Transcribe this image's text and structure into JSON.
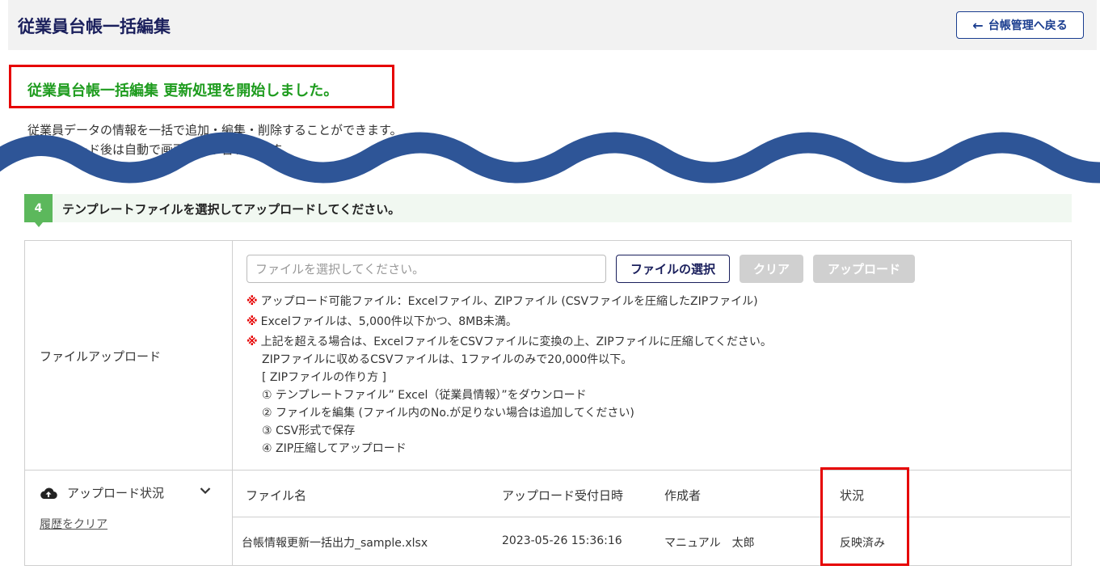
{
  "header": {
    "title": "従業員台帳一括編集",
    "back_button": "台帳管理へ戻る",
    "back_icon": "arrow-left-icon"
  },
  "alert": {
    "message": "従業員台帳一括編集 更新処理を開始しました。"
  },
  "description": {
    "line1": "従業員データの情報を一括で追加・編集・削除することができます。",
    "line2": "アップロード後は自動で画面が切り替わります。"
  },
  "step": {
    "number": "4",
    "text": "テンプレートファイルを選択してアップロードしてください。"
  },
  "upload": {
    "label": "ファイルアップロード",
    "placeholder": "ファイルを選択してください。",
    "select_button": "ファイルの選択",
    "clear_button": "クリア",
    "upload_button": "アップロード",
    "notes": [
      "アップロード可能ファイル：Excelファイル、ZIPファイル (CSVファイルを圧縮したZIPファイル)",
      "Excelファイルは、5,000件以下かつ、8MB未満。",
      "上記を超える場合は、ExcelファイルをCSVファイルに変換の上、ZIPファイルに圧縮してください。"
    ],
    "note_mark": "※",
    "sub_notes": [
      "ZIPファイルに収めるCSVファイルは、1ファイルのみで20,000件以下。",
      "[ ZIPファイルの作り方 ]",
      "① テンプレートファイル” Excel（従業員情報）”をダウンロード",
      "② ファイルを編集 (ファイル内のNo.が足りない場合は追加してください)",
      "③ CSV形式で保存",
      "④ ZIP圧縮してアップロード"
    ]
  },
  "status": {
    "title": "アップロード状況",
    "clear_history": "履歴をクリア",
    "columns": [
      "ファイル名",
      "アップロード受付日時",
      "作成者",
      "状況"
    ],
    "rows": [
      [
        "台帳情報更新一括出力_sample.xlsx",
        "2023-05-26 15:36:16",
        "マニュアル　太郎",
        "反映済み"
      ]
    ]
  },
  "colors": {
    "accent": "#1a1f5c",
    "success": "#1f9c1f",
    "highlight": "#e60000",
    "step_badge": "#5cb85c",
    "wave": "#2e5597"
  }
}
